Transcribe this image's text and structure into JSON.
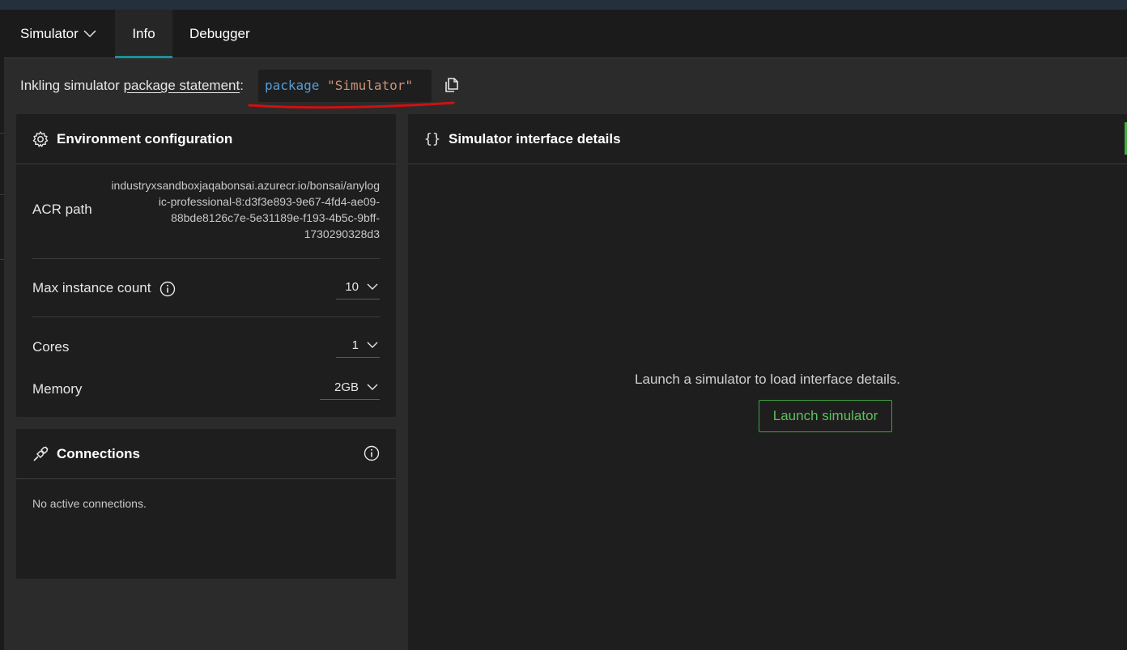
{
  "tabs": {
    "simulator_label": "Simulator",
    "info_label": "Info",
    "debugger_label": "Debugger"
  },
  "package": {
    "prefix": "Inkling simulator ",
    "link_text": "package statement",
    "suffix": ":",
    "code_keyword": "package",
    "code_string": "\"Simulator\""
  },
  "env": {
    "title": "Environment configuration",
    "acr_label": "ACR path",
    "acr_lines": [
      "industryxsandboxjaqabonsai.azurecr.io/bonsai/anylog",
      "ic-professional-8:d3f3e893-9e67-4fd4-ae09-",
      "88bde8126c7e-5e31189e-f193-4b5c-9bff-",
      "1730290328d3"
    ],
    "max_instance_label": "Max instance count",
    "max_instance_value": "10",
    "cores_label": "Cores",
    "cores_value": "1",
    "memory_label": "Memory",
    "memory_value": "2GB"
  },
  "connections": {
    "title": "Connections",
    "empty_text": "No active connections."
  },
  "interface": {
    "title": "Simulator interface details",
    "empty_text": "Launch a simulator to load interface details.",
    "launch_label": "Launch simulator"
  },
  "colors": {
    "accent_tab": "#1f8f9a",
    "launch_green": "#3fa33f",
    "code_keyword": "#569cd6",
    "code_string": "#ce9178",
    "annotation_red": "#d01010"
  },
  "icons": [
    "chevron-down-icon",
    "copy-icon",
    "gear-icon",
    "info-icon",
    "plug-icon",
    "braces-icon"
  ]
}
